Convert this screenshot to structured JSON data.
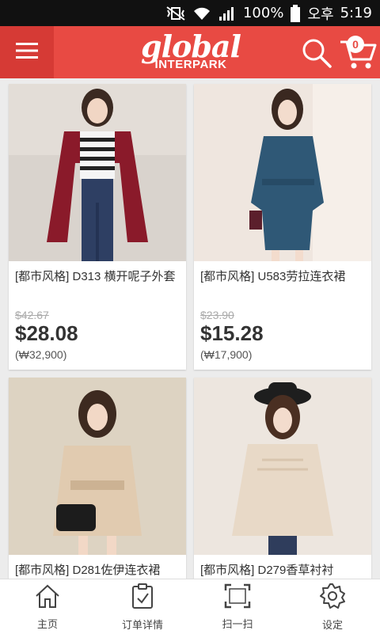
{
  "status_bar": {
    "battery_percent": "100%",
    "ampm": "오후",
    "time": "5:19"
  },
  "app_bar": {
    "logo_main": "global",
    "logo_sub": "INTERPARK",
    "cart_count": "0"
  },
  "products": [
    {
      "name": "[都市风格] D313 横开呢子外套",
      "old_price": "$42.67",
      "price": "$28.08",
      "krw": "(₩32,900)"
    },
    {
      "name": "[都市风格] U583劳拉连衣裙",
      "old_price": "$23.90",
      "price": "$15.28",
      "krw": "(₩17,900)"
    },
    {
      "name": "[都市风格] D281佐伊连衣裙"
    },
    {
      "name": "[都市风格] D279香草衬衬"
    }
  ],
  "bottom_nav": [
    {
      "label": "主页",
      "icon": "home-icon"
    },
    {
      "label": "订单详情",
      "icon": "clipboard-check-icon"
    },
    {
      "label": "扫一扫",
      "icon": "scan-icon"
    },
    {
      "label": "设定",
      "icon": "gear-icon"
    }
  ],
  "colors": {
    "brand_red": "#e84a43",
    "menu_red": "#d63a35"
  }
}
